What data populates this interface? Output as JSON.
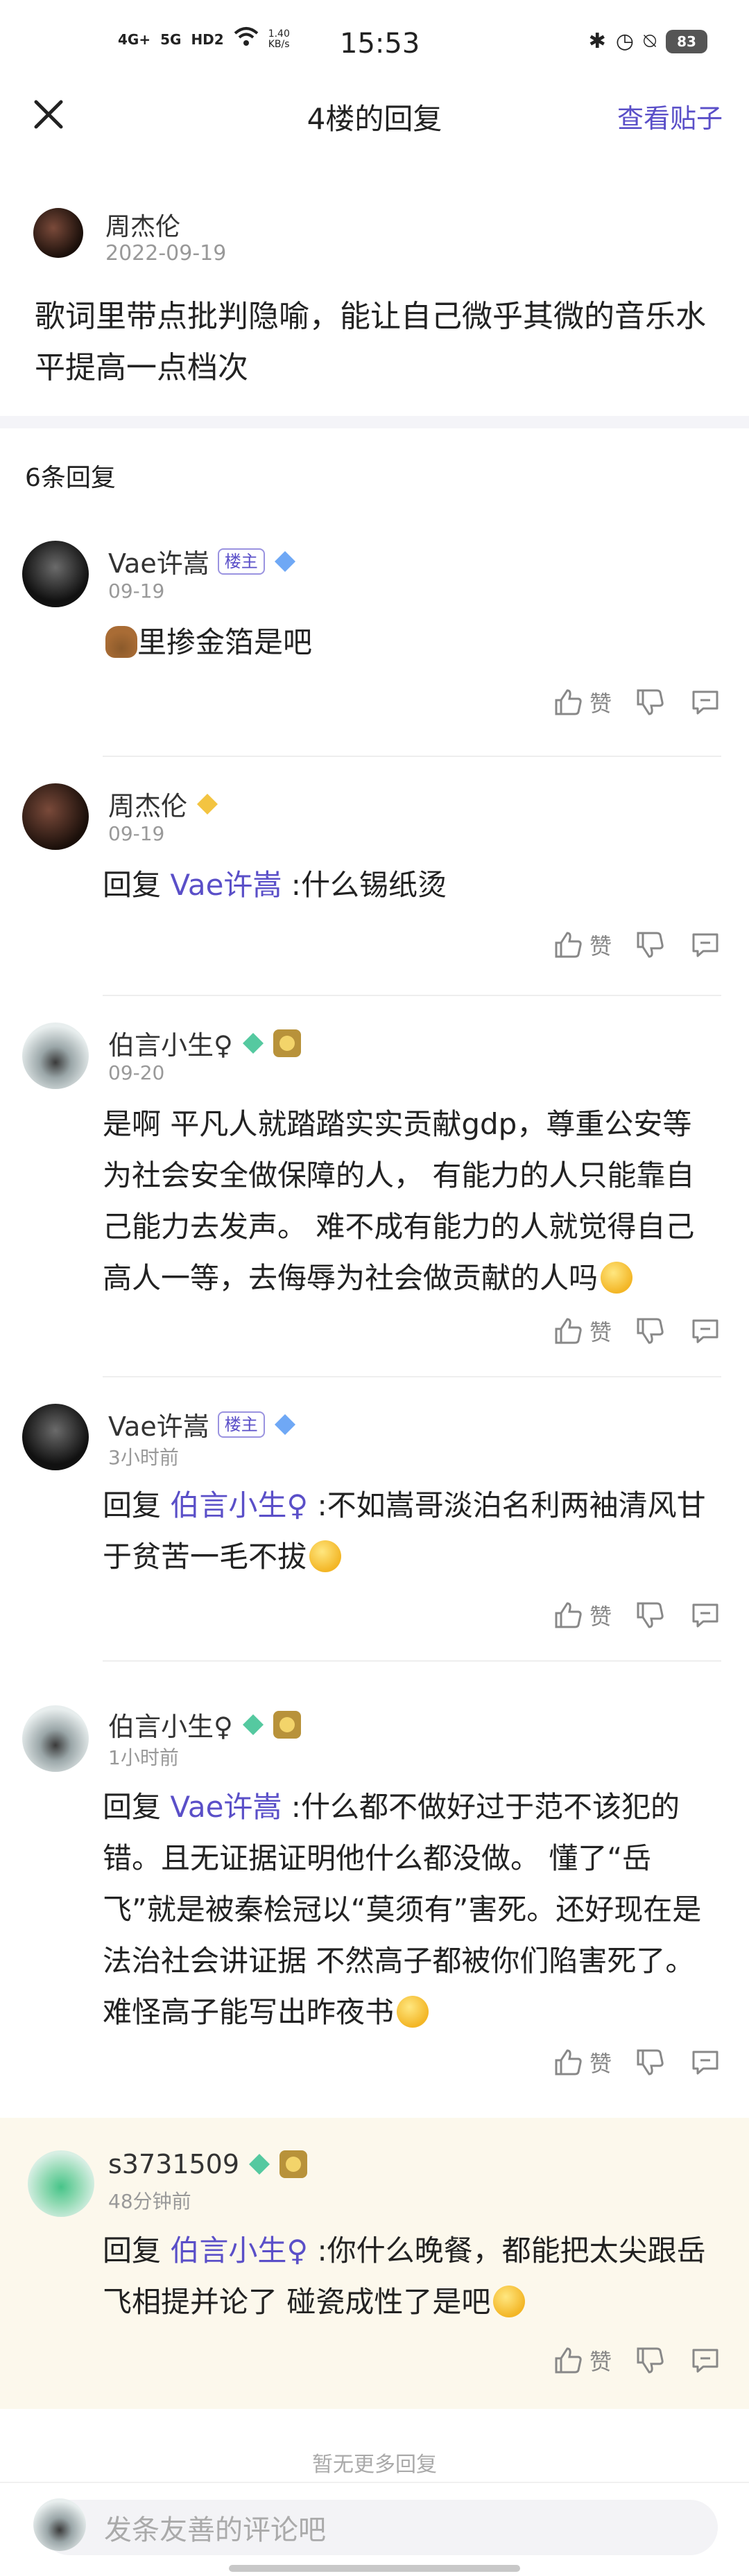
{
  "status_bar": {
    "network1": "4G+",
    "network2": "5G",
    "hd": "HD2",
    "speed": "1.40 KB/s",
    "time": "15:53",
    "battery": "83"
  },
  "header": {
    "title": "4楼的回复",
    "view_post": "查看贴子"
  },
  "main_post": {
    "author": "周杰伦",
    "date": "2022-09-19",
    "text": "歌词里带点批判隐喻，能让自己微乎其微的音乐水平提高一点档次"
  },
  "reply_count": "6条回复",
  "like_label": "赞",
  "reply_prefix": "回复",
  "owner_tag": "楼主",
  "replies": [
    {
      "name": "Vae许嵩",
      "time": "09-19",
      "text": "里掺金箔是吧"
    },
    {
      "name": "周杰伦",
      "time": "09-19",
      "mention": "Vae许嵩",
      "text": ":什么锡纸烫"
    },
    {
      "name": "伯言小生♀",
      "time": "09-20",
      "text": "是啊 平凡人就踏踏实实贡献gdp，尊重公安等为社会安全做保障的人， 有能力的人只能靠自己能力去发声。 难不成有能力的人就觉得自己高人一等，去侮辱为社会做贡献的人吗"
    },
    {
      "name": "Vae许嵩",
      "time": "3小时前",
      "mention": "伯言小生♀",
      "text": ":不如嵩哥淡泊名利两袖清风甘于贫苦一毛不拔"
    },
    {
      "name": "伯言小生♀",
      "time": "1小时前",
      "mention": "Vae许嵩",
      "text": ":什么都不做好过于范不该犯的错。且无证据证明他什么都没做。 懂了“岳飞”就是被秦桧冠以“莫须有”害死。还好现在是法治社会讲证据 不然高子都被你们陷害死了。难怪高子能写出昨夜书"
    },
    {
      "name": "s3731509",
      "time": "48分钟前",
      "mention": "伯言小生♀",
      "text": ":你什么晚餐，都能把太尖跟岳飞相提并论了 碰瓷成性了是吧"
    }
  ],
  "no_more": "暂无更多回复",
  "input_placeholder": "发条友善的评论吧",
  "colors": {
    "accent": "#5a4fc8",
    "highlight_bg": "#fcf8ec"
  }
}
